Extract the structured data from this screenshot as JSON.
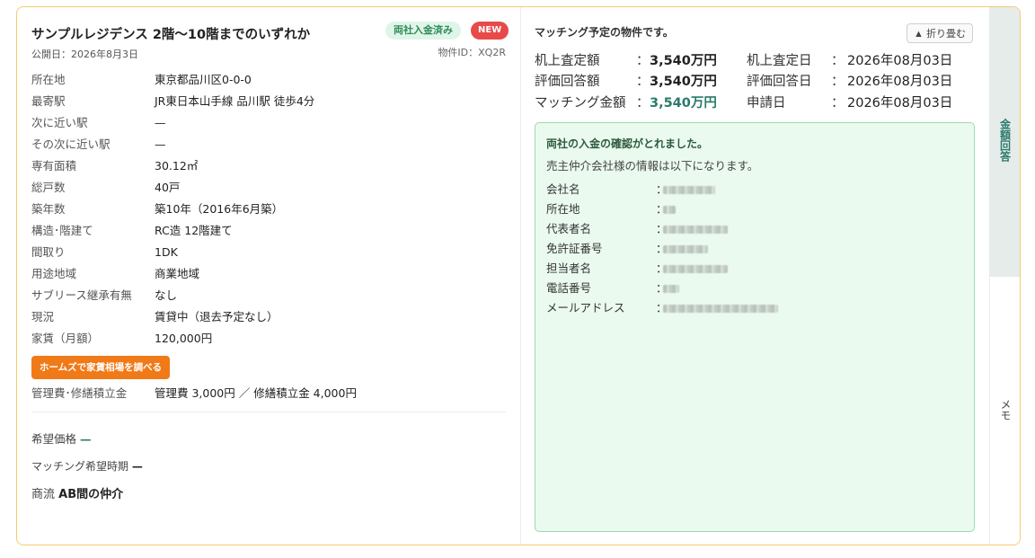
{
  "property": {
    "title": "サンプルレジデンス 2階〜10階までのいずれか",
    "published": "公開日：2026年8月3日",
    "badge_paid": "両社入金済み",
    "badge_new": "NEW",
    "property_id": "物件ID：XQ2R",
    "details": [
      {
        "label": "所在地",
        "value": "東京都品川区0-0-0"
      },
      {
        "label": "最寄駅",
        "value": "JR東日本山手線 品川駅 徒歩4分"
      },
      {
        "label": "次に近い駅",
        "value": "—"
      },
      {
        "label": "その次に近い駅",
        "value": "—"
      },
      {
        "label": "専有面積",
        "value": "30.12㎡"
      },
      {
        "label": "総戸数",
        "value": "40戸"
      },
      {
        "label": "築年数",
        "value": "築10年（2016年6月築）"
      },
      {
        "label": "構造･階建て",
        "value": "RC造 12階建て"
      },
      {
        "label": "間取り",
        "value": "1DK"
      },
      {
        "label": "用途地域",
        "value": "商業地域"
      },
      {
        "label": "サブリース継承有無",
        "value": "なし"
      },
      {
        "label": "現況",
        "value": "賃貸中（退去予定なし）"
      },
      {
        "label": "家賃（月額）",
        "value": "120,000円"
      }
    ],
    "rent_button": "ホームズで家賃相場を調べる",
    "management_label": "管理費･修繕積立金",
    "management_value": "管理費 3,000円 ／ 修繕積立金 4,000円",
    "desired_price_label": "希望価格",
    "desired_price_value": "—",
    "desired_time_label": "マッチング希望時期",
    "desired_time_value": "—",
    "commerce_label": "商流",
    "commerce_value": "AB間の仲介"
  },
  "matching": {
    "header": "マッチング予定の物件です。",
    "fold_button": "▲ 折り畳む",
    "amounts": [
      {
        "label": "机上査定額",
        "value": "3,540万円"
      },
      {
        "label": "評価回答額",
        "value": "3,540万円"
      },
      {
        "label": "マッチング金額",
        "value": "3,540万円"
      }
    ],
    "dates": [
      {
        "label": "机上査定日",
        "value": "2026年08月03日"
      },
      {
        "label": "評価回答日",
        "value": "2026年08月03日"
      },
      {
        "label": "申請日",
        "value": "2026年08月03日"
      }
    ],
    "colon": "：",
    "confirmation_title": "両社の入金の確認がとれました。",
    "confirmation_sub": "売主仲介会社様の情報は以下になります。",
    "seller_fields": [
      {
        "label": "会社名",
        "value": ""
      },
      {
        "label": "所在地",
        "value": ""
      },
      {
        "label": "代表者名",
        "value": ""
      },
      {
        "label": "免許証番号",
        "value": ""
      },
      {
        "label": "担当者名",
        "value": ""
      },
      {
        "label": "電話番号",
        "value": ""
      },
      {
        "label": "メールアドレス",
        "value": ""
      }
    ]
  },
  "side_tabs": {
    "amount_tab": "金額回答",
    "memo_tab": "メモ"
  },
  "colors": {
    "card_border": "#f2cc6e",
    "accent_green": "#2a7a6a",
    "badge_new": "#e84a4a",
    "rent_button": "#f07a17",
    "confirm_bg": "#eafaef"
  }
}
